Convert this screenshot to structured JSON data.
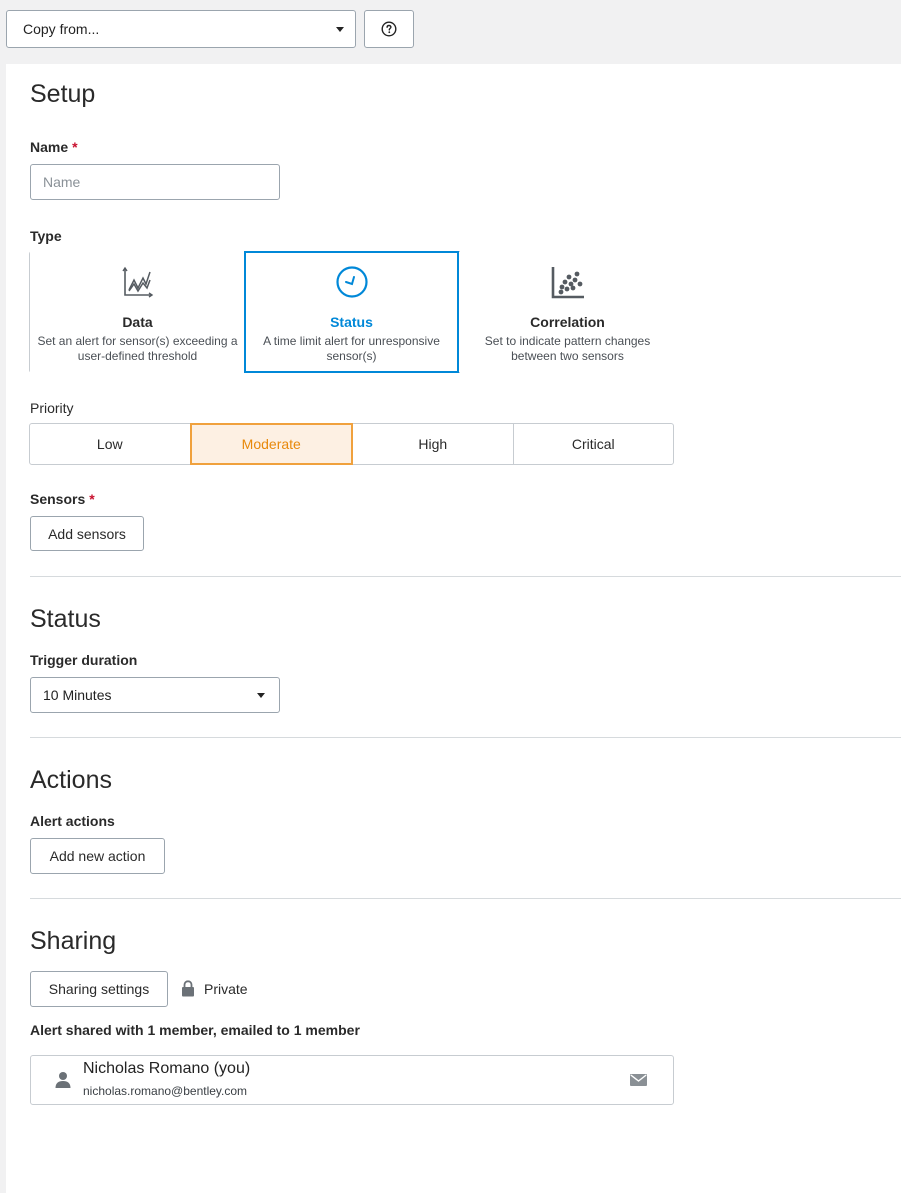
{
  "toolbar": {
    "copy_from_label": "Copy from...",
    "help_icon": "help-circle-icon"
  },
  "setup": {
    "title": "Setup",
    "name_label": "Name",
    "name_required_mark": "*",
    "name_placeholder": "Name",
    "name_value": "",
    "type_label": "Type",
    "types": [
      {
        "title": "Data",
        "desc": "Set an alert for sensor(s) exceeding a user-defined threshold",
        "icon": "line-chart-icon",
        "selected": false
      },
      {
        "title": "Status",
        "desc": "A time limit alert for unresponsive sensor(s)",
        "icon": "clock-icon",
        "selected": true
      },
      {
        "title": "Correlation",
        "desc": "Set to indicate pattern changes between two sensors",
        "icon": "scatter-plot-icon",
        "selected": false
      }
    ],
    "priority_label": "Priority",
    "priorities": [
      "Low",
      "Moderate",
      "High",
      "Critical"
    ],
    "priority_selected": "Moderate",
    "sensors_label": "Sensors",
    "sensors_required_mark": "*",
    "add_sensors_label": "Add sensors"
  },
  "status": {
    "title": "Status",
    "trigger_label": "Trigger duration",
    "trigger_value": "10 Minutes"
  },
  "actions": {
    "title": "Actions",
    "alert_actions_label": "Alert actions",
    "add_action_label": "Add new action"
  },
  "sharing": {
    "title": "Sharing",
    "settings_label": "Sharing settings",
    "privacy_label": "Private",
    "summary": "Alert shared with 1 member, emailed to 1 member",
    "member": {
      "name": "Nicholas Romano (you)",
      "email": "nicholas.romano@bentley.com"
    }
  },
  "colors": {
    "accent_blue": "#0088d8",
    "priority_orange": "#e8890b",
    "required_red": "#c8102e"
  }
}
